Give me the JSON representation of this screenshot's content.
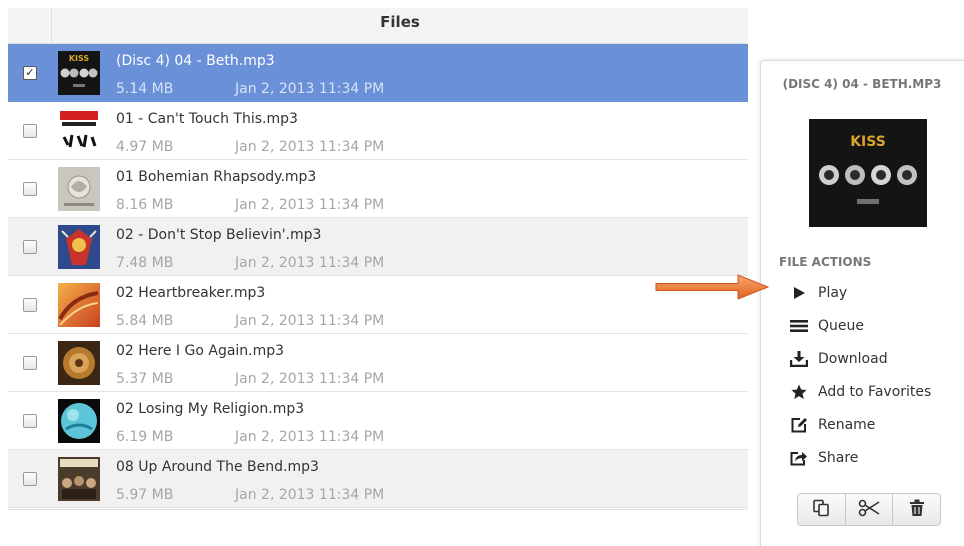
{
  "file_list": {
    "header_title": "Files",
    "rows": [
      {
        "name": "(Disc 4) 04 - Beth.mp3",
        "size": "5.14 MB",
        "date": "Jan 2, 2013 11:34 PM",
        "checked": true,
        "selected": true,
        "thumbnail": "kiss-album-art"
      },
      {
        "name": "01 - Can't Touch This.mp3",
        "size": "4.97 MB",
        "date": "Jan 2, 2013 11:34 PM",
        "checked": false,
        "selected": false,
        "thumbnail": "hip-hop-album-art"
      },
      {
        "name": "01 Bohemian Rhapsody.mp3",
        "size": "8.16 MB",
        "date": "Jan 2, 2013 11:34 PM",
        "checked": false,
        "selected": false,
        "thumbnail": "queen-album-art"
      },
      {
        "name": "02 - Don't Stop Believin'.mp3",
        "size": "7.48 MB",
        "date": "Jan 2, 2013 11:34 PM",
        "checked": false,
        "selected": false,
        "thumbnail": "journey-album-art"
      },
      {
        "name": "02 Heartbreaker.mp3",
        "size": "5.84 MB",
        "date": "Jan 2, 2013 11:34 PM",
        "checked": false,
        "selected": false,
        "thumbnail": "led-zeppelin-album-art"
      },
      {
        "name": "02 Here I Go Again.mp3",
        "size": "5.37 MB",
        "date": "Jan 2, 2013 11:34 PM",
        "checked": false,
        "selected": false,
        "thumbnail": "whitesnake-album-art"
      },
      {
        "name": "02 Losing My Religion.mp3",
        "size": "6.19 MB",
        "date": "Jan 2, 2013 11:34 PM",
        "checked": false,
        "selected": false,
        "thumbnail": "rem-album-art"
      },
      {
        "name": "08 Up Around The Bend.mp3",
        "size": "5.97 MB",
        "date": "Jan 2, 2013 11:34 PM",
        "checked": false,
        "selected": false,
        "thumbnail": "ccr-album-art"
      }
    ]
  },
  "details": {
    "title": "(DISC 4) 04 - BETH.MP3",
    "album_art_label": "KISS",
    "actions_heading": "FILE ACTIONS",
    "actions": [
      {
        "label": "Play",
        "icon": "play-icon"
      },
      {
        "label": "Queue",
        "icon": "queue-icon"
      },
      {
        "label": "Download",
        "icon": "download-icon"
      },
      {
        "label": "Add to Favorites",
        "icon": "star-icon"
      },
      {
        "label": "Rename",
        "icon": "rename-icon"
      },
      {
        "label": "Share",
        "icon": "share-icon"
      }
    ],
    "toolbar": [
      {
        "name": "copy",
        "icon": "copy-icon"
      },
      {
        "name": "cut",
        "icon": "scissors-icon"
      },
      {
        "name": "delete",
        "icon": "trash-icon"
      }
    ]
  },
  "colors": {
    "selected_row": "#6a90d8",
    "alt_row": "#f1f1f1",
    "callout_arrow": "#f07a3a"
  }
}
